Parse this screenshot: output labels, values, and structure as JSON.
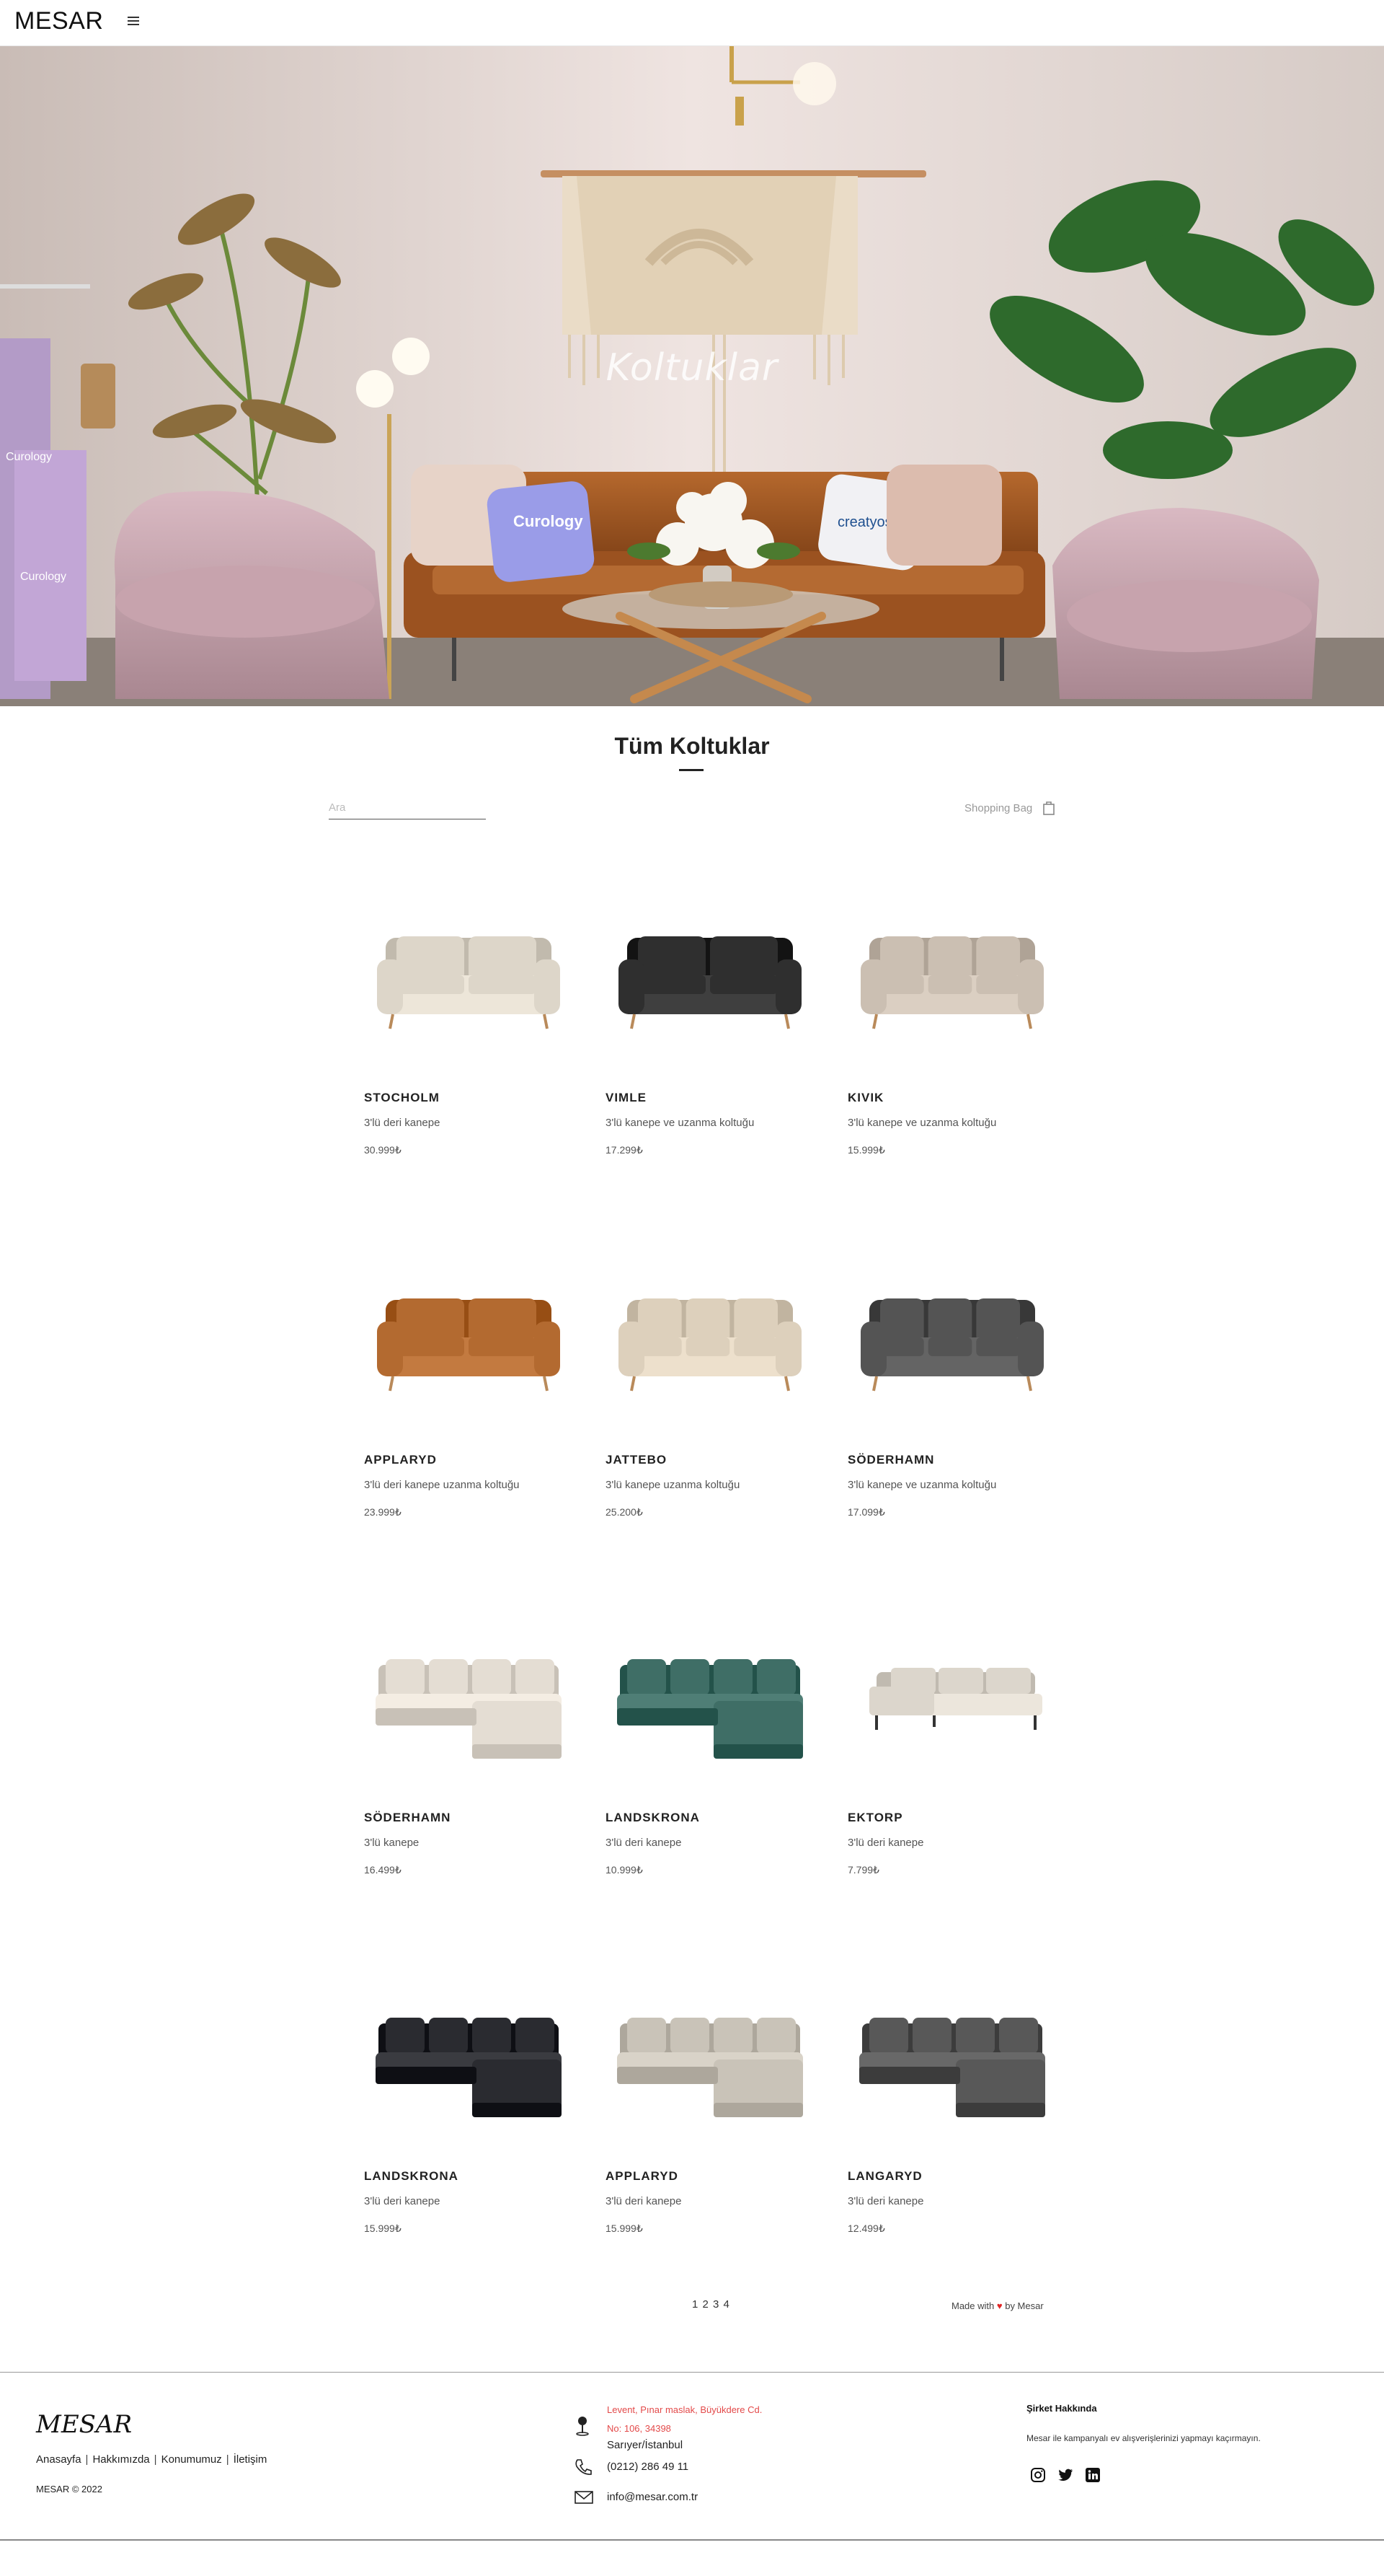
{
  "navbar": {
    "brand": "MESAR",
    "menu_icon": "hamburger-menu-icon"
  },
  "hero": {
    "title": "Koltuklar",
    "pillow_left_text": "Curology",
    "pillow_right_text": "creatyoskin",
    "towel_text_1": "Curology",
    "towel_text_2": "Curology"
  },
  "catalog": {
    "title": "Tüm Koltuklar",
    "search_placeholder": "Ara",
    "shopping_bag_label": "Shopping Bag",
    "bag_icon": "shopping-bag-icon",
    "products": [
      {
        "name": "STOCHOLM",
        "desc": "3'lü deri kanepe",
        "price": "30.999₺",
        "color": "#ddd6c9",
        "shape": "sofa-2"
      },
      {
        "name": "VIMLE",
        "desc": "3'lü kanepe ve uzanma koltuğu",
        "price": "17.299₺",
        "color": "#2f2f2f",
        "shape": "sofa-2"
      },
      {
        "name": "KIVIK",
        "desc": "3'lü kanepe ve uzanma koltuğu",
        "price": "15.999₺",
        "color": "#cbbfb2",
        "shape": "sofa-3"
      },
      {
        "name": "APPLARYD",
        "desc": "3'lü deri kanepe uzanma koltuğu",
        "price": "23.999₺",
        "color": "#b36a30",
        "shape": "sofa-2"
      },
      {
        "name": "JATTEBO",
        "desc": "3'lü kanepe uzanma koltuğu",
        "price": "25.200₺",
        "color": "#ddd0bc",
        "shape": "sofa-3"
      },
      {
        "name": "SÖDERHAMN",
        "desc": "3'lü kanepe ve uzanma koltuğu",
        "price": "17.099₺",
        "color": "#545454",
        "shape": "sofa-3"
      },
      {
        "name": "SÖDERHAMN",
        "desc": "3'lü kanepe",
        "price": "16.499₺",
        "color": "#e4ddd3",
        "shape": "sectional"
      },
      {
        "name": "LANDSKRONA",
        "desc": "3'lü deri kanepe",
        "price": "10.999₺",
        "color": "#3f6e66",
        "shape": "sectional"
      },
      {
        "name": "EKTORP",
        "desc": "3'lü deri kanepe",
        "price": "7.799₺",
        "color": "#dcd6cc",
        "shape": "chaise"
      },
      {
        "name": "LANDSKRONA",
        "desc": "3'lü deri kanepe",
        "price": "15.999₺",
        "color": "#2a2b30",
        "shape": "sectional"
      },
      {
        "name": "APPLARYD",
        "desc": "3'lü deri kanepe",
        "price": "15.999₺",
        "color": "#c9c3b8",
        "shape": "sectional"
      },
      {
        "name": "LANGARYD",
        "desc": "3'lü deri kanepe",
        "price": "12.499₺",
        "color": "#585858",
        "shape": "sectional"
      }
    ]
  },
  "pagination": {
    "pages": [
      "1",
      "2",
      "3",
      "4"
    ]
  },
  "made_with": {
    "prefix": "Made with",
    "suffix": "by Mesar",
    "heart": "♥"
  },
  "footer": {
    "logo": "MESAR",
    "links": [
      "Anasayfa",
      "Hakkımızda",
      "Konumumuz",
      "İletişim"
    ],
    "copyright": "MESAR © 2022",
    "address_line1": "Levent, Pınar maslak, Büyükdere Cd.",
    "address_line2": "No: 106, 34398",
    "address_line3": "Sarıyer/İstanbul",
    "phone": "(0212) 286 49 11",
    "email": "info@mesar.com.tr",
    "about_title": "Şirket Hakkında",
    "about_text": "Mesar ile kampanyalı ev alışverişlerinizi yapmayı kaçırmayın.",
    "social_icons": [
      "instagram-icon",
      "twitter-icon",
      "linkedin-icon"
    ],
    "accent_red": "#e34a4a"
  }
}
